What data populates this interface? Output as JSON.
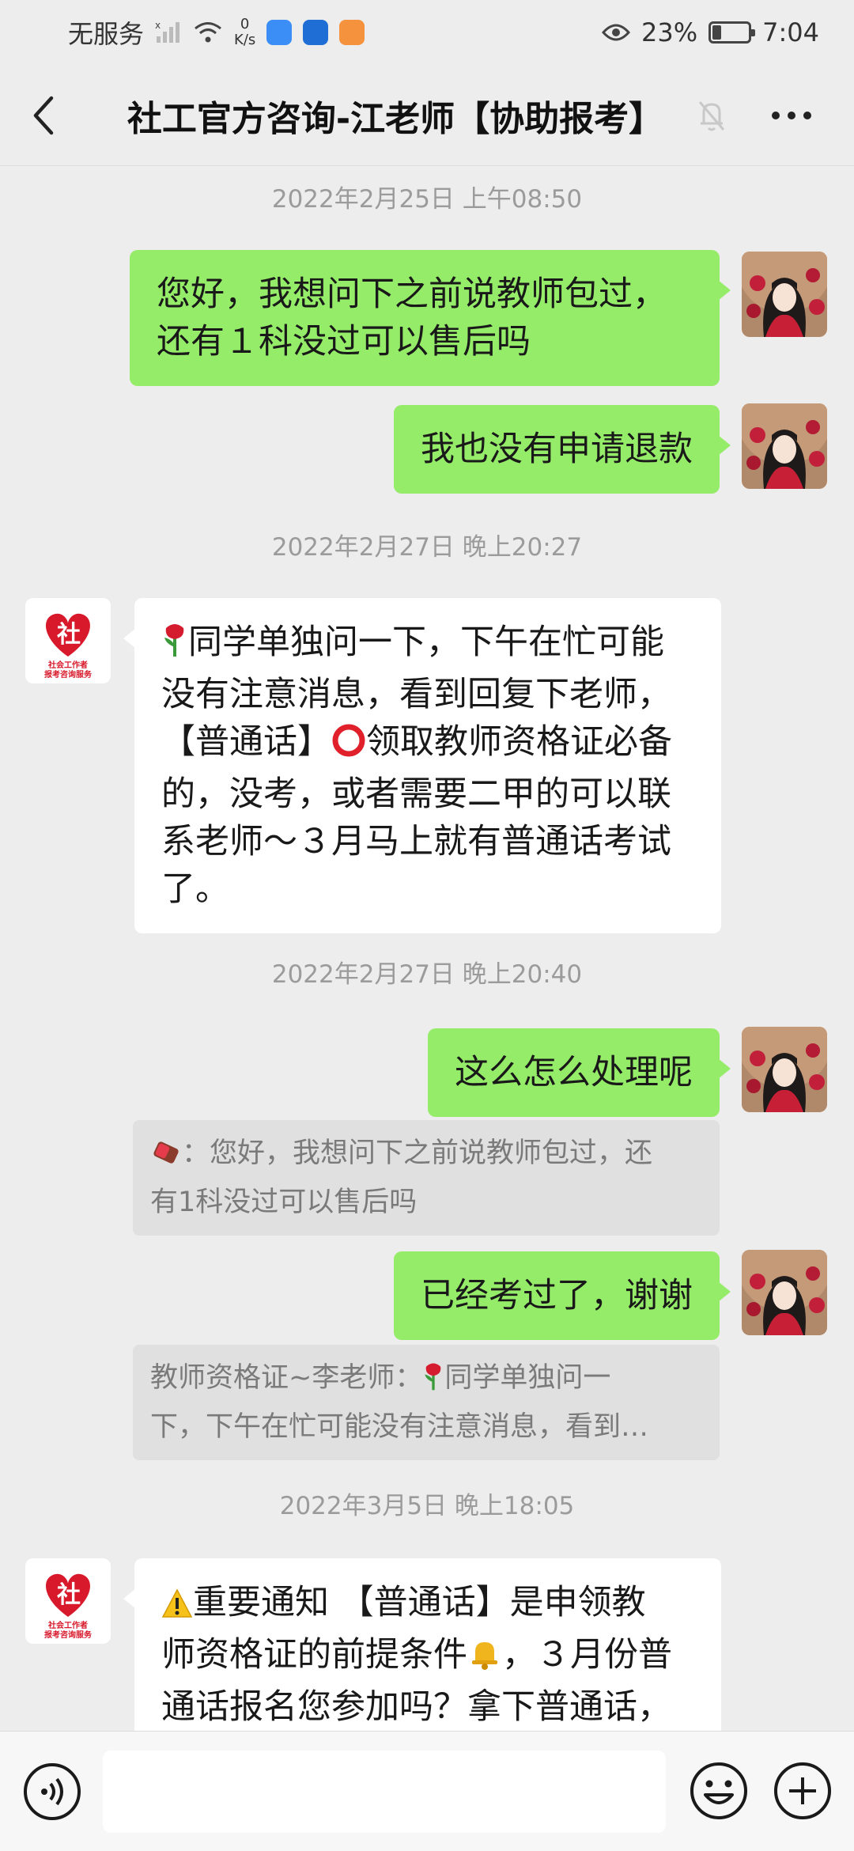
{
  "status_bar": {
    "carrier": "无服务",
    "speed_value": "0",
    "speed_unit": "K/s",
    "battery": "23%",
    "time": "7:04"
  },
  "header": {
    "title": "社工官方咨询-江老师【协助报考】"
  },
  "messages": {
    "ts1": "2022年2月25日 上午08:50",
    "m1_line1": "您好，我想问下之前说教师包过，",
    "m1_line2": "还有１科没过可以售后吗",
    "m2": "我也没有申请退款",
    "ts2": "2022年2月27日 晚上20:27",
    "m3_l1": "同学单独问一下，下午在忙可能",
    "m3_l2": "没有注意消息，看到回复下老师，",
    "m3_l3a": "【普通话】",
    "m3_l3b": "领取教师资格证必备",
    "m3_l4": "的，没考，或者需要二甲的可以联",
    "m3_l5": "系老师～３月马上就有普通话考试",
    "m3_l6": "了。",
    "ts3": "2022年2月27日 晚上20:40",
    "m4": "这么怎么处理呢",
    "q1_l1": "：您好，我想问下之前说教师包过，还",
    "q1_l2": "有1科没过可以售后吗",
    "m5": "已经考过了，谢谢",
    "q2_l1a": "教师资格证~李老师：",
    "q2_l1b": "同学单独问一",
    "q2_l2": "下，下午在忙可能没有注意消息，看到…",
    "ts4": "2022年3月5日 晚上18:05",
    "m6_l1": "重要通知 【普通话】是申领教",
    "m6_l2a": "师资格证的前提条件",
    "m6_l2b": "，３月份普",
    "m6_l3": "通话报名您参加吗？拿下普通话，"
  },
  "logo": {
    "line1": "社会工作者",
    "line2": "报考咨询服务"
  },
  "colors": {
    "my_bubble": "#95ec69",
    "their_bubble": "#ffffff",
    "background": "#ededed",
    "logo_red": "#d8192b"
  },
  "icons": [
    "back-arrow-icon",
    "mute-bell-icon",
    "more-dots-icon",
    "voice-icon",
    "emoji-icon",
    "plus-icon",
    "rose-icon",
    "red-circle-icon",
    "warning-icon",
    "bell-icon",
    "candy-icon"
  ]
}
